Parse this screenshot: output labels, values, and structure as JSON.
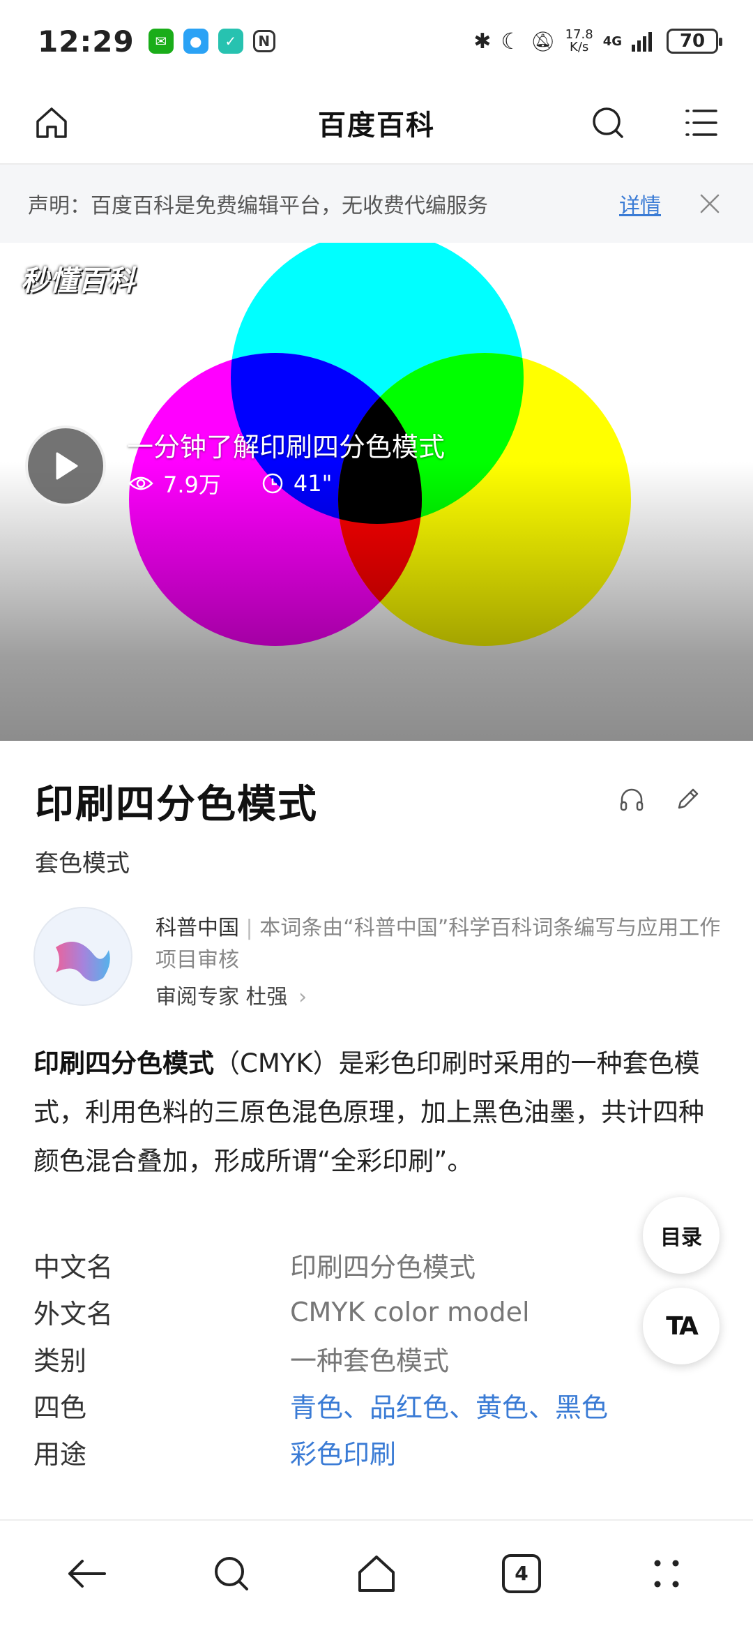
{
  "status_bar": {
    "time": "12:29",
    "network_speed_value": "17.8",
    "network_speed_unit": "K/s",
    "network_type": "4G",
    "battery": "70"
  },
  "header": {
    "title": "百度百科"
  },
  "notice": {
    "text": "声明：百度百科是免费编辑平台，无收费代编服务",
    "link_label": "详情"
  },
  "video": {
    "brand_logo": "秒懂百科",
    "title": "一分钟了解印刷四分色模式",
    "views": "7.9万",
    "duration": "41\""
  },
  "entry": {
    "title": "印刷四分色模式",
    "subtitle": "套色模式",
    "author_name": "科普中国",
    "author_desc": "本词条由“科普中国”科学百科词条编写与应用工作项目审核",
    "reviewer": "审阅专家 杜强",
    "summary_bold": "印刷四分色模式",
    "summary_rest": "（CMYK）是彩色印刷时采用的一种套色模式，利用色料的三原色混色原理，加上黑色油墨，共计四种颜色混合叠加，形成所谓“全彩印刷”。"
  },
  "info_box": [
    {
      "key": "中文名",
      "value": "印刷四分色模式",
      "is_link": false
    },
    {
      "key": "外文名",
      "value": "CMYK color model",
      "is_link": false
    },
    {
      "key": "类别",
      "value": "一种套色模式",
      "is_link": false
    },
    {
      "key": "四色",
      "value": "青色、品红色、黄色、黑色",
      "is_link": true
    },
    {
      "key": "用途",
      "value": "彩色印刷",
      "is_link": true
    }
  ],
  "floating": {
    "toc_label": "目录",
    "ta_label": "TA"
  },
  "bottom_nav": {
    "tab_count": "4"
  },
  "colors": {
    "link": "#3a7bd5",
    "cyan": "#00ffff",
    "magenta": "#ff00ff",
    "yellow": "#ffff00"
  }
}
